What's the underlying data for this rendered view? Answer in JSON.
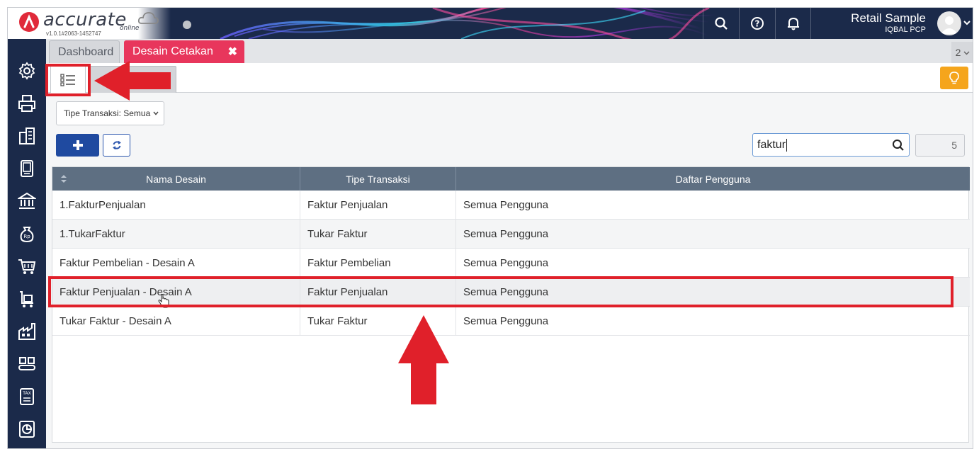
{
  "app": {
    "brand": "accurate",
    "brand_sub": "online",
    "version": "v1.0.1#2063-1452747"
  },
  "header": {
    "company": "Retail Sample",
    "user": "IQBAL PCP",
    "icons": [
      "search-icon",
      "help-icon",
      "bell-icon",
      "avatar",
      "chevron-down-icon"
    ]
  },
  "sidebar": {
    "items": [
      "settings-icon",
      "printer-icon",
      "building-icon",
      "ledger-icon",
      "bank-icon",
      "money-bag-icon",
      "cart-icon",
      "warehouse-cart-icon",
      "factory-icon",
      "conveyor-icon",
      "tax-icon",
      "report-icon"
    ]
  },
  "tabs": {
    "dashboard": "Dashboard",
    "active": "Desain Cetakan",
    "close_glyph": "✖",
    "count": "2"
  },
  "toolbar": {
    "filter_label": "Tipe Transaksi: Semua",
    "search_value": "faktur",
    "record_count": "5"
  },
  "table": {
    "columns": [
      "Nama Desain",
      "Tipe Transaksi",
      "Daftar Pengguna"
    ],
    "rows": [
      {
        "nama": "1.FakturPenjualan",
        "tipe": "Faktur Penjualan",
        "pengguna": "Semua Pengguna"
      },
      {
        "nama": "1.TukarFaktur",
        "tipe": "Tukar Faktur",
        "pengguna": "Semua Pengguna"
      },
      {
        "nama": "Faktur Pembelian - Desain A",
        "tipe": "Faktur Pembelian",
        "pengguna": "Semua Pengguna"
      },
      {
        "nama": "Faktur Penjualan - Desain A",
        "tipe": "Faktur Penjualan",
        "pengguna": "Semua Pengguna"
      },
      {
        "nama": "Tukar Faktur - Desain A",
        "tipe": "Tukar Faktur",
        "pengguna": "Semua Pengguna"
      }
    ],
    "highlighted_row": 3
  },
  "colors": {
    "navy": "#1b2a4a",
    "active_tab": "#e8365c",
    "primary": "#1f4aa0",
    "annotation_red": "#e0202a",
    "bulb": "#f5a51c"
  }
}
